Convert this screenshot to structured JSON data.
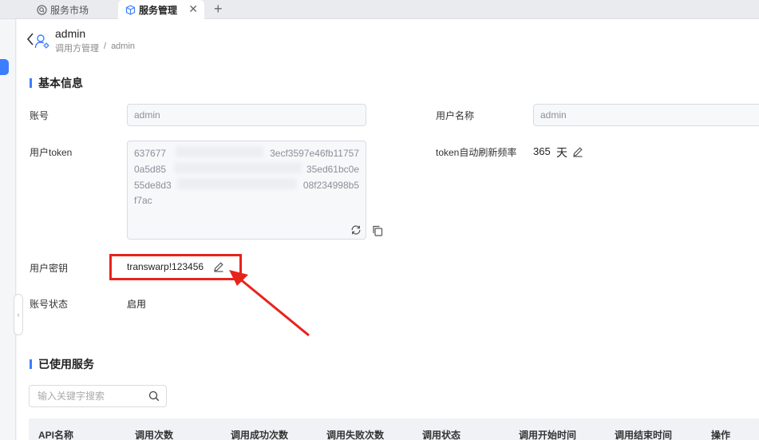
{
  "tabs": [
    {
      "label": "服务市场",
      "icon": "search-circle-icon",
      "active": false
    },
    {
      "label": "服务管理",
      "icon": "cube-icon",
      "active": true
    }
  ],
  "header": {
    "title": "admin",
    "breadcrumb": [
      "调用方管理",
      "/",
      "admin"
    ]
  },
  "basic_info": {
    "section_title": "基本信息",
    "account_label": "账号",
    "account_value": "admin",
    "username_label": "用户名称",
    "username_value": "admin",
    "token_label": "用户token",
    "token_lines": [
      "637677",
      "3ecf3597e46fb11757",
      "0a5d85",
      "35ed61bc0e",
      "55de8d3",
      "08f234998b5",
      "f7ac"
    ],
    "token_refresh_label": "token自动刷新频率",
    "token_refresh_value": "365",
    "token_refresh_unit": "天",
    "secret_label": "用户密钥",
    "secret_value": "transwarp!123456",
    "status_label": "账号状态",
    "status_value": "启用"
  },
  "services": {
    "section_title": "已使用服务",
    "search_placeholder": "输入关键字搜索",
    "columns": [
      "API名称",
      "调用次数",
      "调用成功次数",
      "调用失败次数",
      "调用状态",
      "调用开始时间",
      "调用结束时间",
      "操作"
    ]
  },
  "colors": {
    "accent": "#3c7eff",
    "annotation": "#e8231b"
  }
}
